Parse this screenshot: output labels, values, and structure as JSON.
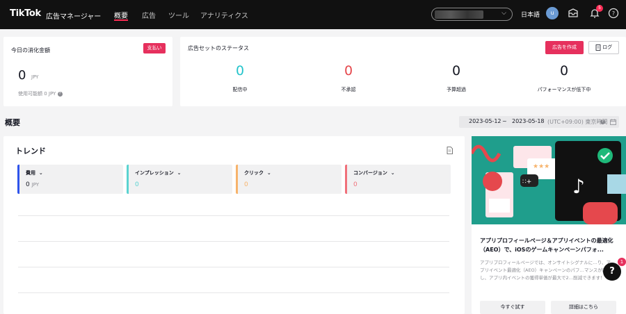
{
  "topbar": {
    "logo": "TikTok",
    "logo_sub": "広告マネージャー",
    "tabs": [
      "概要",
      "広告",
      "ツール",
      "アナリティクス"
    ],
    "active_tab": "概要",
    "language": "日本語",
    "avatar_letter": "u",
    "notification_count": "5"
  },
  "spend_card": {
    "title": "今日の消化金額",
    "pay_button": "支払い",
    "amount": "0",
    "unit": "JPY",
    "available": "使用可能額 0 JPY"
  },
  "status_card": {
    "title": "広告セットのステータス",
    "create_button": "広告を作成",
    "log_button": "ログ",
    "stats": [
      {
        "value": "0",
        "label": "配信中"
      },
      {
        "value": "0",
        "label": "不承認"
      },
      {
        "value": "0",
        "label": "予算超過"
      },
      {
        "value": "0",
        "label": "パフォーマンスが低下中"
      }
    ]
  },
  "overview": {
    "heading": "概要",
    "date_start": "2023-05-12",
    "date_sep": "~",
    "date_end": "2023-05-18",
    "timezone": "(UTC+09:00) 東京時間"
  },
  "trend": {
    "title": "トレンド",
    "metrics": [
      {
        "label": "費用",
        "value": "0",
        "unit": "JPY"
      },
      {
        "label": "インプレッション",
        "value": "0"
      },
      {
        "label": "クリック",
        "value": "0"
      },
      {
        "label": "コンバージョン",
        "value": "0"
      }
    ]
  },
  "promo": {
    "title": "アプリプロフィールページ＆アプリイベントの最適化（AEO）で、iOSのゲームキャンペーンパフォ...",
    "body": "アプリプロフィールページでは、オンサイトシグナルに…り、アプリイベント最適化（AEO）キャンペーンのパフ…マンスが向上し、アプリ内イベントの獲得単価が最大で2…削減できます！",
    "button_now": "今すぐ試す",
    "button_details": "詳細はこちら",
    "help_badge": "1"
  },
  "colors": {
    "accent": "#e6305d",
    "teal": "#25c4cb",
    "red": "#e5484d",
    "metric_blue": "#2f54eb",
    "metric_teal": "#5ad3d1",
    "metric_orange": "#f7b36b",
    "metric_red": "#f0707a"
  }
}
